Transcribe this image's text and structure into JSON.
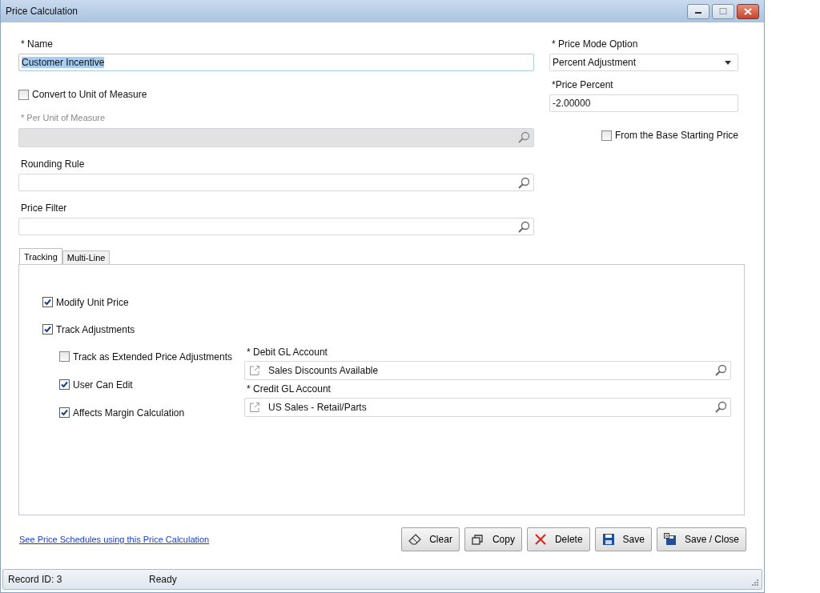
{
  "window": {
    "title": "Price Calculation"
  },
  "name": {
    "label": "* Name",
    "value": "Customer Incentive"
  },
  "convert": {
    "label": "Convert to Unit of Measure",
    "checked": false
  },
  "per_unit": {
    "label": "* Per Unit of Measure",
    "disabled": true
  },
  "rounding_rule": {
    "label": "Rounding Rule"
  },
  "price_filter": {
    "label": "Price Filter"
  },
  "price_mode": {
    "label": "* Price Mode Option",
    "value": "Percent Adjustment"
  },
  "price_percent": {
    "label": "*Price Percent",
    "value": "-2.00000"
  },
  "from_base": {
    "label": "From the Base Starting Price",
    "checked": false
  },
  "tabs": [
    {
      "label": "Tracking",
      "selected": true
    },
    {
      "label": "Multi-Line",
      "selected": false
    }
  ],
  "tracking": {
    "top_checks": [
      {
        "label": "Modify Unit Price",
        "checked": true
      },
      {
        "label": "Track Adjustments",
        "checked": true
      }
    ],
    "sub_checks": [
      {
        "label": "Track as Extended Price Adjustments",
        "checked": false
      },
      {
        "label": "User Can Edit",
        "checked": true
      },
      {
        "label": "Affects Margin Calculation",
        "checked": true
      }
    ],
    "accounts": [
      {
        "label": "* Debit GL Account",
        "value": "Sales Discounts Available"
      },
      {
        "label": "* Credit GL Account",
        "value": "US Sales - Retail/Parts"
      }
    ]
  },
  "link": "See Price Schedules using this Price Calculation",
  "buttons": [
    {
      "label": "Clear",
      "kind": "clear"
    },
    {
      "label": "Copy",
      "kind": "copy"
    },
    {
      "label": "Delete",
      "kind": "delete"
    },
    {
      "label": "Save",
      "kind": "save"
    },
    {
      "label": "Save / Close",
      "kind": "saveclose"
    }
  ],
  "status_bar": {
    "record": "Record ID: 3",
    "status": "Ready"
  }
}
